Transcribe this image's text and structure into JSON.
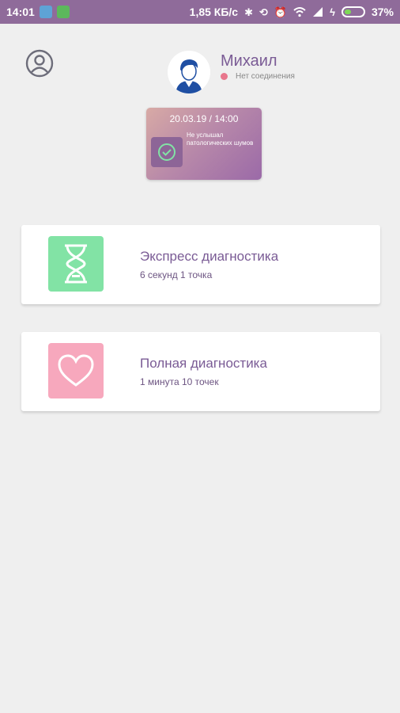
{
  "status_bar": {
    "time": "14:01",
    "network_speed": "1,85 КБ/с",
    "battery": "37%",
    "battery_level": 0.37,
    "icons": [
      "location-app-icon",
      "android-app-icon",
      "bluetooth-icon",
      "sync-off-icon",
      "alarm-icon",
      "wifi-icon",
      "signal-icon",
      "charging-icon",
      "battery-icon"
    ]
  },
  "header": {
    "profile_icon": "profile-icon",
    "user_name": "Михаил",
    "connection_status": "Нет соединения",
    "connection_color": "#e8768c"
  },
  "last_result": {
    "datetime": "20.03.19 / 14:00",
    "message": "Не услышал патологических шумов",
    "icon": "check-circle-icon"
  },
  "diagnostics": [
    {
      "title": "Экспресс диагностика",
      "subtitle": "6 секунд 1 точка",
      "icon": "hourglass-icon",
      "tile_color": "#82e3a5"
    },
    {
      "title": "Полная диагностика",
      "subtitle": "1 минута 10 точек",
      "icon": "heart-icon",
      "tile_color": "#f7a8bd"
    }
  ],
  "colors": {
    "status_bar": "#8f6b9a",
    "accent": "#7a5b95",
    "background": "#efefef"
  }
}
